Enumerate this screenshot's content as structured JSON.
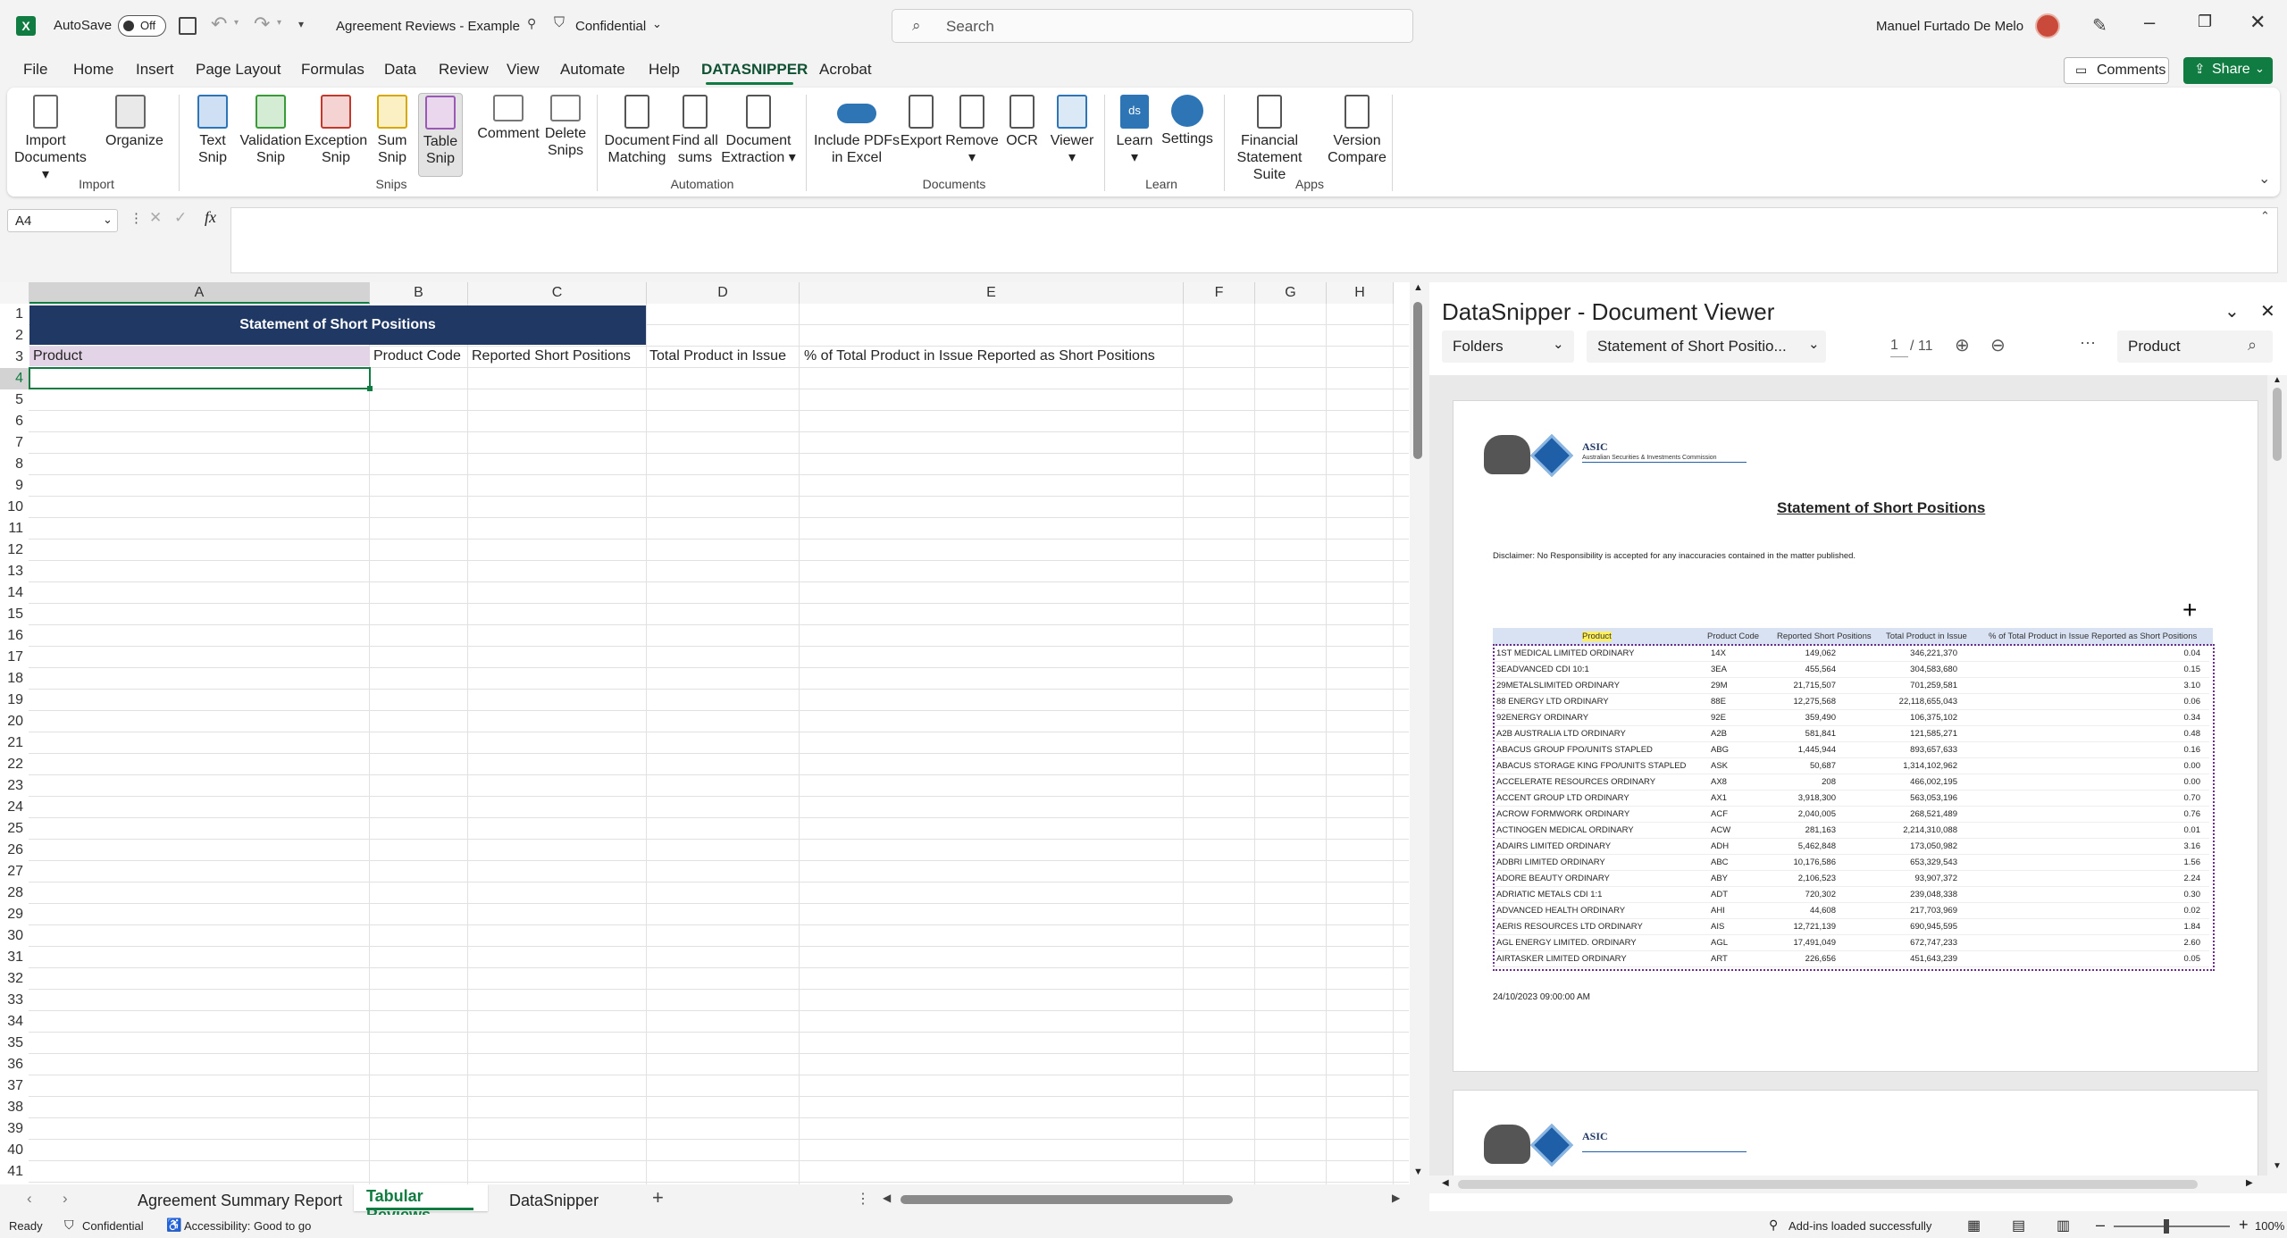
{
  "titlebar": {
    "autosave_label": "AutoSave",
    "autosave_state": "Off",
    "doc_title": "Agreement Reviews - Example",
    "sensitivity": "Confidential",
    "search_placeholder": "Search",
    "user_name": "Manuel Furtado De Melo"
  },
  "menu": {
    "tabs": [
      "File",
      "Home",
      "Insert",
      "Page Layout",
      "Formulas",
      "Data",
      "Review",
      "View",
      "Automate",
      "Help",
      "DATASNIPPER",
      "Acrobat"
    ],
    "active": "DATASNIPPER",
    "comments_label": "Comments",
    "share_label": "Share"
  },
  "ribbon": {
    "import_documents": "Import Documents",
    "organize": "Organize",
    "text_snip": "Text Snip",
    "validation_snip": "Validation Snip",
    "exception_snip": "Exception Snip",
    "sum_snip": "Sum Snip",
    "table_snip": "Table Snip",
    "comment": "Comment",
    "delete_snips": "Delete Snips",
    "document_matching": "Document Matching",
    "find_all_sums": "Find all sums",
    "document_extraction": "Document Extraction",
    "include_pdfs": "Include PDFs in Excel",
    "export": "Export",
    "remove": "Remove",
    "ocr": "OCR",
    "viewer": "Viewer",
    "learn": "Learn",
    "settings": "Settings",
    "financial_statement_suite": "Financial Statement Suite",
    "version_compare": "Version Compare",
    "groups": {
      "import": "Import",
      "snips": "Snips",
      "automation": "Automation",
      "documents": "Documents",
      "learn": "Learn",
      "apps": "Apps"
    }
  },
  "formula_bar": {
    "name_box": "A4",
    "formula": ""
  },
  "sheet": {
    "columns": [
      "A",
      "B",
      "C",
      "D",
      "E",
      "F",
      "G",
      "H"
    ],
    "rows": [
      "1",
      "2",
      "3",
      "4",
      "5",
      "6",
      "7",
      "8",
      "9",
      "10",
      "11",
      "12",
      "13",
      "14",
      "15",
      "16",
      "17",
      "18",
      "19",
      "20",
      "21",
      "22",
      "23",
      "24",
      "25",
      "26",
      "27",
      "28",
      "29",
      "30",
      "31",
      "32",
      "33",
      "34",
      "35",
      "36",
      "37",
      "38",
      "39",
      "40",
      "41"
    ],
    "title_cell": "Statement of Short Positions",
    "headers": [
      "Product",
      "Product Code",
      "Reported Short Positions",
      "Total Product in Issue",
      "% of Total Product in Issue Reported as Short Positions"
    ]
  },
  "sheet_tabs": {
    "tabs": [
      "Agreement Summary Report",
      "Tabular Reviews",
      "DataSnipper"
    ],
    "active": "Tabular Reviews"
  },
  "status": {
    "ready": "Ready",
    "sensitivity": "Confidential",
    "accessibility": "Accessibility: Good to go",
    "addins": "Add-ins loaded successfully",
    "zoom": "100%"
  },
  "viewer": {
    "title": "DataSnipper - Document Viewer",
    "folder_dropdown": "Folders",
    "doc_dropdown": "Statement of Short Positio...",
    "page_current": "1",
    "page_total": "/ 11",
    "search_value": "Product",
    "doc": {
      "org": "ASIC",
      "org_sub": "Australian Securities & Investments Commission",
      "heading": "Statement of Short Positions",
      "disclaimer": "Disclaimer: No Responsibility is accepted for any inaccuracies contained in the matter published.",
      "columns": [
        "Product",
        "Product Code",
        "Reported Short Positions",
        "Total Product in Issue",
        "% of Total Product in Issue Reported as Short Positions"
      ],
      "rows": [
        [
          "1ST MEDICAL LIMITED ORDINARY",
          "14X",
          "149,062",
          "346,221,370",
          "0.04"
        ],
        [
          "3EADVANCED CDI 10:1",
          "3EA",
          "455,564",
          "304,583,680",
          "0.15"
        ],
        [
          "29METALSLIMITED ORDINARY",
          "29M",
          "21,715,507",
          "701,259,581",
          "3.10"
        ],
        [
          "88 ENERGY LTD ORDINARY",
          "88E",
          "12,275,568",
          "22,118,655,043",
          "0.06"
        ],
        [
          "92ENERGY ORDINARY",
          "92E",
          "359,490",
          "106,375,102",
          "0.34"
        ],
        [
          "A2B AUSTRALIA LTD ORDINARY",
          "A2B",
          "581,841",
          "121,585,271",
          "0.48"
        ],
        [
          "ABACUS GROUP FPO/UNITS STAPLED",
          "ABG",
          "1,445,944",
          "893,657,633",
          "0.16"
        ],
        [
          "ABACUS STORAGE KING FPO/UNITS STAPLED",
          "ASK",
          "50,687",
          "1,314,102,962",
          "0.00"
        ],
        [
          "ACCELERATE RESOURCES ORDINARY",
          "AX8",
          "208",
          "466,002,195",
          "0.00"
        ],
        [
          "ACCENT GROUP LTD ORDINARY",
          "AX1",
          "3,918,300",
          "563,053,196",
          "0.70"
        ],
        [
          "ACROW FORMWORK ORDINARY",
          "ACF",
          "2,040,005",
          "268,521,489",
          "0.76"
        ],
        [
          "ACTINOGEN MEDICAL ORDINARY",
          "ACW",
          "281,163",
          "2,214,310,088",
          "0.01"
        ],
        [
          "ADAIRS LIMITED ORDINARY",
          "ADH",
          "5,462,848",
          "173,050,982",
          "3.16"
        ],
        [
          "ADBRI LIMITED ORDINARY",
          "ABC",
          "10,176,586",
          "653,329,543",
          "1.56"
        ],
        [
          "ADORE BEAUTY ORDINARY",
          "ABY",
          "2,106,523",
          "93,907,372",
          "2.24"
        ],
        [
          "ADRIATIC METALS CDI 1:1",
          "ADT",
          "720,302",
          "239,048,338",
          "0.30"
        ],
        [
          "ADVANCED HEALTH ORDINARY",
          "AHI",
          "44,608",
          "217,703,969",
          "0.02"
        ],
        [
          "AERIS RESOURCES LTD ORDINARY",
          "AIS",
          "12,721,139",
          "690,945,595",
          "1.84"
        ],
        [
          "AGL ENERGY LIMITED. ORDINARY",
          "AGL",
          "17,491,049",
          "672,747,233",
          "2.60"
        ],
        [
          "AIRTASKER LIMITED ORDINARY",
          "ART",
          "226,656",
          "451,643,239",
          "0.05"
        ]
      ],
      "date": "24/10/2023 09:00:00 AM"
    }
  },
  "colors": {
    "excel_green": "#107c41",
    "title_fill": "#1f3864",
    "header_fill": "#e4d4e7",
    "ds_accent": "#2e75b6"
  }
}
